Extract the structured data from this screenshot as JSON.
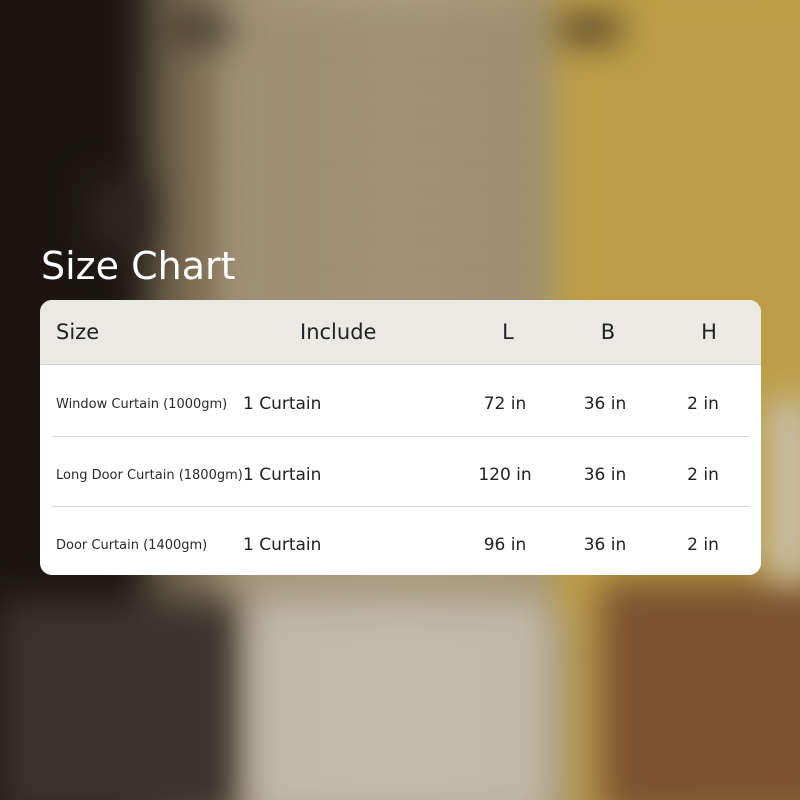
{
  "title": "Size Chart",
  "table": {
    "headers": {
      "size": "Size",
      "include": "Include",
      "l": "L",
      "b": "B",
      "h": "H"
    },
    "rows": [
      {
        "size": "Window Curtain (1000gm)",
        "include": "1 Curtain",
        "l": "72 in",
        "b": "36 in",
        "h": "2 in"
      },
      {
        "size": "Long Door Curtain (1800gm)",
        "include": "1 Curtain",
        "l": "120 in",
        "b": "36 in",
        "h": "2 in"
      },
      {
        "size": "Door Curtain (1400gm)",
        "include": "1 Curtain",
        "l": "96 in",
        "b": "36 in",
        "h": "2 in"
      }
    ]
  },
  "colors": {
    "title_text": "#ffffff",
    "card_background": "#ffffff",
    "header_background": "#ebe9e4",
    "text": "#222222",
    "divider": "#d9d6d0"
  }
}
